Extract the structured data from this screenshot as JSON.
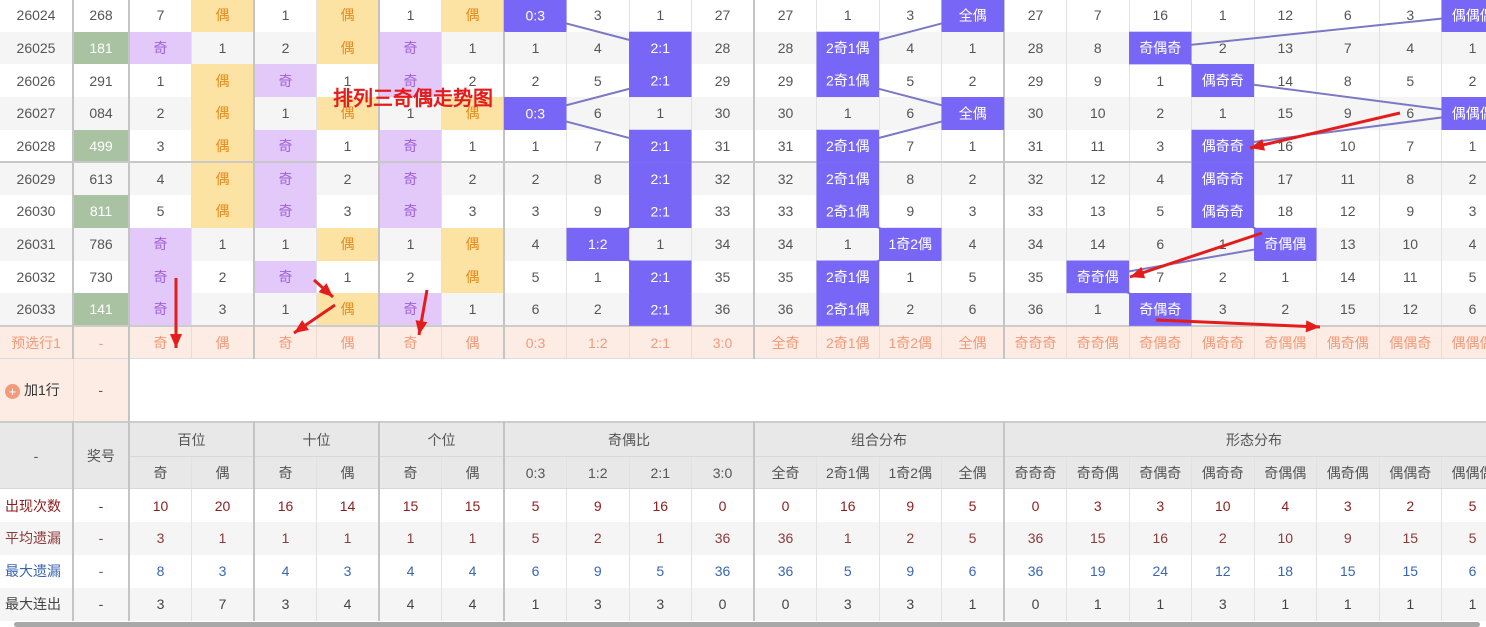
{
  "title_annotation": "排列三奇偶走势图",
  "colors": {
    "hit": "#7867f7",
    "odd": "#e3c9fa",
    "even": "#fde3a3",
    "annotation": "#e51c1c",
    "trend_line": "#7b78c4"
  },
  "groups": [
    {
      "label": "百位",
      "cols": [
        "奇",
        "偶"
      ]
    },
    {
      "label": "十位",
      "cols": [
        "奇",
        "偶"
      ]
    },
    {
      "label": "个位",
      "cols": [
        "奇",
        "偶"
      ]
    },
    {
      "label": "奇偶比",
      "cols": [
        "0:3",
        "1:2",
        "2:1",
        "3:0"
      ]
    },
    {
      "label": "组合分布",
      "cols": [
        "全奇",
        "2奇1偶",
        "1奇2偶",
        "全偶"
      ]
    },
    {
      "label": "形态分布",
      "cols": [
        "奇奇奇",
        "奇奇偶",
        "奇偶奇",
        "偶奇奇",
        "奇偶偶",
        "偶奇偶",
        "偶偶奇",
        "偶偶偶"
      ]
    }
  ],
  "rows": [
    {
      "issue": "26024",
      "number": "268",
      "hi": false,
      "cells": [
        "7",
        "偶",
        "1",
        "偶",
        "1",
        "偶",
        "0:3",
        "3",
        "1",
        "27",
        "27",
        "1",
        "3",
        "全偶",
        "27",
        "7",
        "16",
        "1",
        "12",
        "6",
        "3",
        "偶偶偶"
      ]
    },
    {
      "issue": "26025",
      "number": "181",
      "hi": true,
      "cells": [
        "奇",
        "1",
        "2",
        "偶",
        "奇",
        "1",
        "1",
        "4",
        "2:1",
        "28",
        "28",
        "2奇1偶",
        "4",
        "1",
        "28",
        "8",
        "奇偶奇",
        "2",
        "13",
        "7",
        "4",
        "1"
      ]
    },
    {
      "issue": "26026",
      "number": "291",
      "hi": false,
      "cells": [
        "1",
        "偶",
        "奇",
        "1",
        "奇",
        "2",
        "2",
        "5",
        "2:1",
        "29",
        "29",
        "2奇1偶",
        "5",
        "2",
        "29",
        "9",
        "1",
        "偶奇奇",
        "14",
        "8",
        "5",
        "2"
      ]
    },
    {
      "issue": "26027",
      "number": "084",
      "hi": false,
      "cells": [
        "2",
        "偶",
        "1",
        "偶",
        "1",
        "偶",
        "0:3",
        "6",
        "1",
        "30",
        "30",
        "1",
        "6",
        "全偶",
        "30",
        "10",
        "2",
        "1",
        "15",
        "9",
        "6",
        "偶偶偶"
      ]
    },
    {
      "issue": "26028",
      "number": "499",
      "hi": true,
      "cells": [
        "3",
        "偶",
        "奇",
        "1",
        "奇",
        "1",
        "1",
        "7",
        "2:1",
        "31",
        "31",
        "2奇1偶",
        "7",
        "1",
        "31",
        "11",
        "3",
        "偶奇奇",
        "16",
        "10",
        "7",
        "1"
      ]
    },
    {
      "issue": "26029",
      "number": "613",
      "hi": false,
      "cells": [
        "4",
        "偶",
        "奇",
        "2",
        "奇",
        "2",
        "2",
        "8",
        "2:1",
        "32",
        "32",
        "2奇1偶",
        "8",
        "2",
        "32",
        "12",
        "4",
        "偶奇奇",
        "17",
        "11",
        "8",
        "2"
      ]
    },
    {
      "issue": "26030",
      "number": "811",
      "hi": true,
      "cells": [
        "5",
        "偶",
        "奇",
        "3",
        "奇",
        "3",
        "3",
        "9",
        "2:1",
        "33",
        "33",
        "2奇1偶",
        "9",
        "3",
        "33",
        "13",
        "5",
        "偶奇奇",
        "18",
        "12",
        "9",
        "3"
      ]
    },
    {
      "issue": "26031",
      "number": "786",
      "hi": false,
      "cells": [
        "奇",
        "1",
        "1",
        "偶",
        "1",
        "偶",
        "4",
        "1:2",
        "1",
        "34",
        "34",
        "1",
        "1奇2偶",
        "4",
        "34",
        "14",
        "6",
        "1",
        "奇偶偶",
        "13",
        "10",
        "4"
      ]
    },
    {
      "issue": "26032",
      "number": "730",
      "hi": false,
      "cells": [
        "奇",
        "2",
        "奇",
        "1",
        "2",
        "偶",
        "5",
        "1",
        "2:1",
        "35",
        "35",
        "2奇1偶",
        "1",
        "5",
        "35",
        "奇奇偶",
        "7",
        "2",
        "1",
        "14",
        "11",
        "5"
      ]
    },
    {
      "issue": "26033",
      "number": "141",
      "hi": true,
      "cells": [
        "奇",
        "3",
        "1",
        "偶",
        "奇",
        "1",
        "6",
        "2",
        "2:1",
        "36",
        "36",
        "2奇1偶",
        "2",
        "6",
        "36",
        "1",
        "奇偶奇",
        "3",
        "2",
        "15",
        "12",
        "6"
      ]
    }
  ],
  "preselect": {
    "label": "预选行1",
    "number": "-"
  },
  "add_row": {
    "label": "加1行",
    "number": "-",
    "icon": "plus-circle-icon"
  },
  "header": {
    "corner": "-",
    "number": "奖号"
  },
  "stats": [
    {
      "label": "出现次数",
      "number": "-",
      "values": [
        "10",
        "20",
        "16",
        "14",
        "15",
        "15",
        "5",
        "9",
        "16",
        "0",
        "0",
        "16",
        "9",
        "5",
        "0",
        "3",
        "3",
        "10",
        "4",
        "3",
        "2",
        "5"
      ]
    },
    {
      "label": "平均遗漏",
      "number": "-",
      "values": [
        "3",
        "1",
        "1",
        "1",
        "1",
        "1",
        "5",
        "2",
        "1",
        "36",
        "36",
        "1",
        "2",
        "5",
        "36",
        "15",
        "16",
        "2",
        "10",
        "9",
        "15",
        "5"
      ]
    },
    {
      "label": "最大遗漏",
      "number": "-",
      "values": [
        "8",
        "3",
        "4",
        "3",
        "4",
        "4",
        "6",
        "9",
        "5",
        "36",
        "36",
        "5",
        "9",
        "6",
        "36",
        "19",
        "24",
        "12",
        "18",
        "15",
        "15",
        "6"
      ]
    },
    {
      "label": "最大连出",
      "number": "-",
      "values": [
        "3",
        "7",
        "3",
        "4",
        "4",
        "4",
        "1",
        "3",
        "3",
        "0",
        "0",
        "3",
        "3",
        "1",
        "0",
        "1",
        "1",
        "3",
        "1",
        "1",
        "1",
        "1"
      ]
    }
  ]
}
